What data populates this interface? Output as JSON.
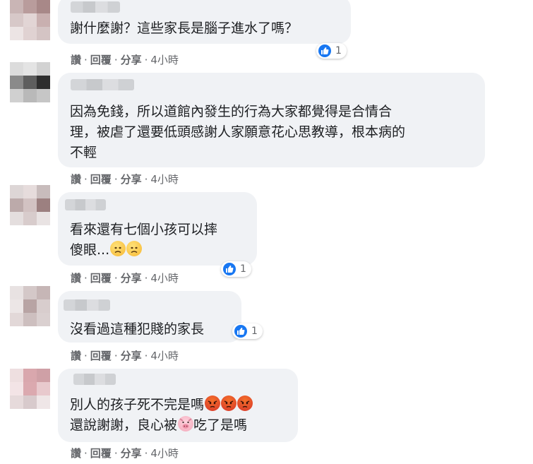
{
  "actions": {
    "like": "讚",
    "reply": "回覆",
    "share": "分享",
    "sep": "·"
  },
  "comments": [
    {
      "text": [
        "謝什麼謝？這些家長是腦子進水了嗎？"
      ],
      "time": "4小時",
      "reactions": "1"
    },
    {
      "text": [
        "因為免錢，所以道館內發生的行為大家都覺得是合情合",
        "理，被虐了還要低頭感謝人家願意花心思教導，根本病的",
        "不輕"
      ],
      "time": "4小時",
      "reactions": ""
    },
    {
      "text": [
        "看來還有七個小孩可以摔",
        "傻眼..."
      ],
      "time": "4小時",
      "reactions": "1"
    },
    {
      "text": [
        "沒看過這種犯賤的家長"
      ],
      "time": "4小時",
      "reactions": "1"
    },
    {
      "text": [
        "別人的孩子死不完是嗎",
        "還說謝謝，良心被",
        "吃了是嗎"
      ],
      "time": "4小時",
      "reactions": ""
    }
  ],
  "emoji_names": [
    "sad-face-icon",
    "angry-face-icon",
    "pig-face-icon"
  ]
}
